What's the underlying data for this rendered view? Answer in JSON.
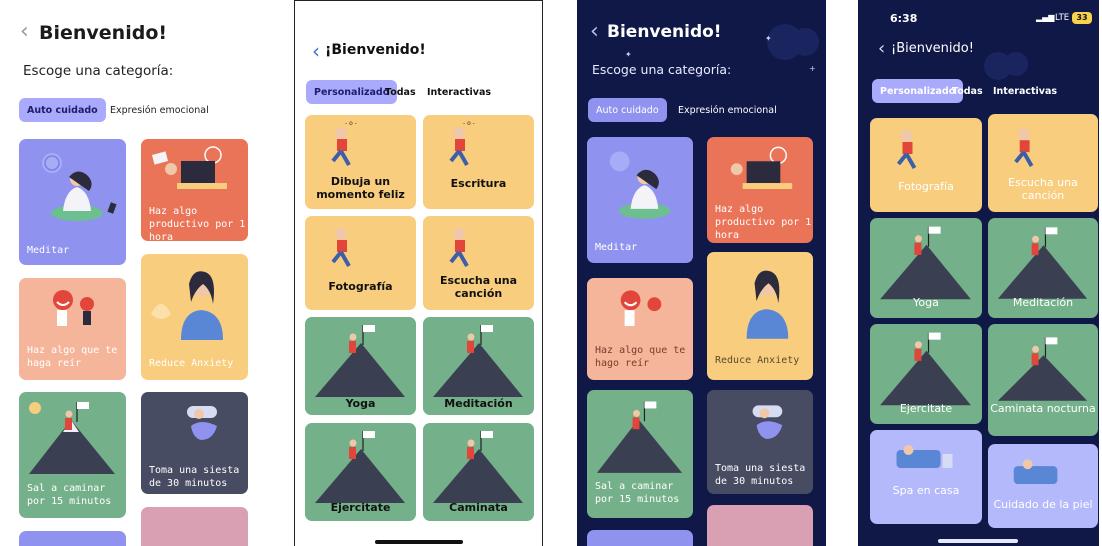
{
  "colors": {
    "purple": "#8f93ef",
    "coral": "#ea7458",
    "peach": "#f5b59b",
    "sand": "#f8cd7e",
    "green": "#74b08a",
    "slate": "#474c62",
    "pink": "#d9a0b3",
    "navy": "#101848",
    "lavender": "#b3b9fb"
  },
  "screen1": {
    "title": "Bienvenido!",
    "subtitle": "Escoge una categoría:",
    "tabs": [
      "Auto cuidado",
      "Expresión emocional"
    ],
    "cards": [
      "Meditar",
      "Haz algo productivo por 1 hora",
      "Haz algo que te haga reír",
      "Reduce Anxiety",
      "Sal a caminar por 15 minutos",
      "Toma una siesta de 30 minutos"
    ]
  },
  "screen2": {
    "title": "¡Bienvenido!",
    "tabs": [
      "Personalizado",
      "Todas",
      "Interactivas"
    ],
    "cards": [
      "Dibuja un momento feliz",
      "Escritura",
      "Fotografía",
      "Escucha una canción",
      "Yoga",
      "Meditación",
      "Ejercitate",
      "Caminata"
    ]
  },
  "screen3": {
    "title": "Bienvenido!",
    "subtitle": "Escoge una categoría:",
    "tabs": [
      "Auto cuidado",
      "Expresión emocional"
    ],
    "cards": [
      "Meditar",
      "Haz algo productivo por 1 hora",
      "Haz algo que te hago reír",
      "Reduce Anxiety",
      "Sal a caminar por 15 minutos",
      "Toma una siesta de 30 minutos"
    ]
  },
  "screen4": {
    "status": {
      "time": "6:38",
      "network": "LTE",
      "battery": "33"
    },
    "title": "¡Bienvenido!",
    "tabs": [
      "Personalizado",
      "Todas",
      "Interactivas"
    ],
    "cards": [
      "Fotografía",
      "Escucha una canción",
      "Yoga",
      "Meditación",
      "Ejercitate",
      "Caminata nocturna",
      "Spa en casa",
      "Cuidado de la piel"
    ]
  }
}
